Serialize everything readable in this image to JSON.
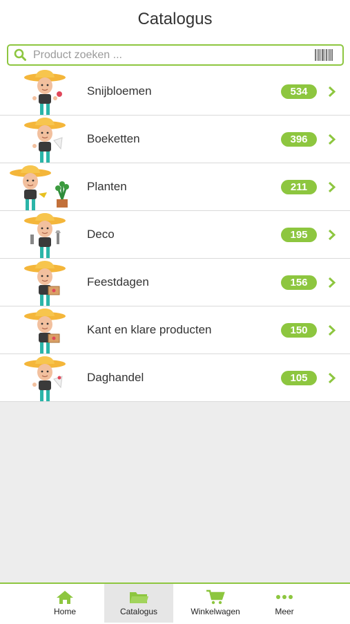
{
  "header": {
    "title": "Catalogus"
  },
  "search": {
    "placeholder": "Product zoeken ...",
    "search_icon": "search-icon",
    "barcode_icon": "barcode-icon"
  },
  "categories": [
    {
      "label": "Snijbloemen",
      "count": "534"
    },
    {
      "label": "Boeketten",
      "count": "396"
    },
    {
      "label": "Planten",
      "count": "211"
    },
    {
      "label": "Deco",
      "count": "195"
    },
    {
      "label": "Feestdagen",
      "count": "156"
    },
    {
      "label": "Kant en klare producten",
      "count": "150"
    },
    {
      "label": "Daghandel",
      "count": "105"
    }
  ],
  "tabs": [
    {
      "label": "Home",
      "icon": "home-icon"
    },
    {
      "label": "Catalogus",
      "icon": "folder-icon",
      "active": true
    },
    {
      "label": "Winkelwagen",
      "icon": "cart-icon"
    },
    {
      "label": "Meer",
      "icon": "more-icon"
    }
  ],
  "colors": {
    "accent": "#8dc63f",
    "text": "#333333",
    "background": "#ededed"
  }
}
